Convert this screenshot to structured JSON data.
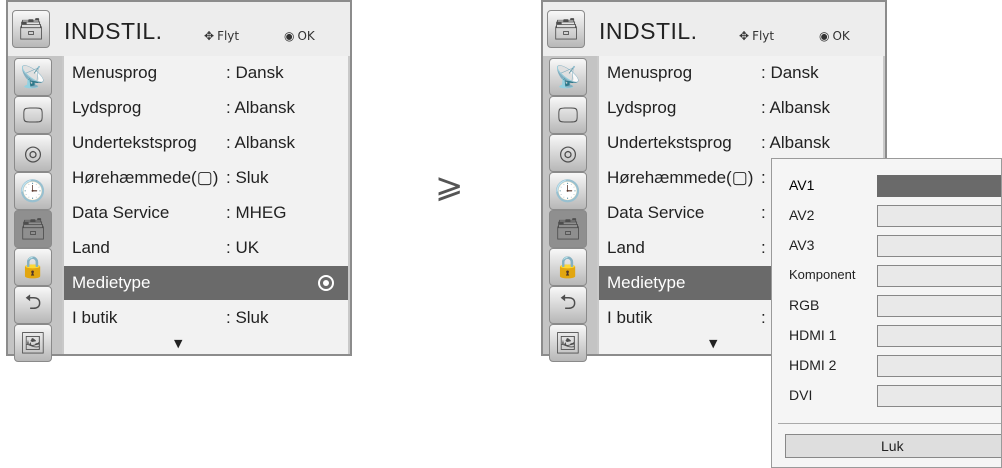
{
  "menu": {
    "title": "INDSTIL.",
    "move_hint": "Flyt",
    "ok_hint": "OK",
    "items": [
      {
        "label": "Menusprog",
        "value": ": Dansk"
      },
      {
        "label": "Lydsprog",
        "value": ": Albansk"
      },
      {
        "label": "Undertekstsprog",
        "value": ": Albansk"
      },
      {
        "label": "Hørehæmmede(▢)",
        "value": ": Sluk"
      },
      {
        "label": "Data Service",
        "value": ": MHEG"
      },
      {
        "label": "Land",
        "value": ": UK"
      },
      {
        "label": "Medietype",
        "value": ""
      },
      {
        "label": "I butik",
        "value": ": Sluk"
      }
    ],
    "selected_item": "Medietype",
    "sidebar_icons": [
      "satellite-icon",
      "monitor-icon",
      "speaker-icon",
      "clock-icon",
      "toolbox-icon",
      "lock-icon",
      "input-plug-icon",
      "photo-icon"
    ],
    "more_arrow": "▼"
  },
  "right_menu": {
    "title": "INDSTIL.",
    "move_hint": "Flyt",
    "ok_hint": "OK",
    "items": [
      {
        "label": "Menusprog",
        "value": ": Dansk"
      },
      {
        "label": "Lydsprog",
        "value": ": Albansk"
      },
      {
        "label": "Undertekstsprog",
        "value": ": Albansk"
      },
      {
        "label": "Hørehæmmede(▢)",
        "value": ":"
      },
      {
        "label": "Data Service",
        "value": ":"
      },
      {
        "label": "Land",
        "value": ":"
      },
      {
        "label": "Medietype",
        "value": ""
      },
      {
        "label": "I butik",
        "value": ":"
      }
    ]
  },
  "transition_arrow": "⩾",
  "popup": {
    "options": [
      "AV1",
      "AV2",
      "AV3",
      "Komponent",
      "RGB",
      "HDMI 1",
      "HDMI 2",
      "DVI"
    ],
    "active": "AV1",
    "close_label": "Luk"
  },
  "colors": {
    "selected_bg": "#6a6a6a",
    "panel_bg": "#f2f2f2",
    "sidebar_bg": "#c4c4c4"
  }
}
